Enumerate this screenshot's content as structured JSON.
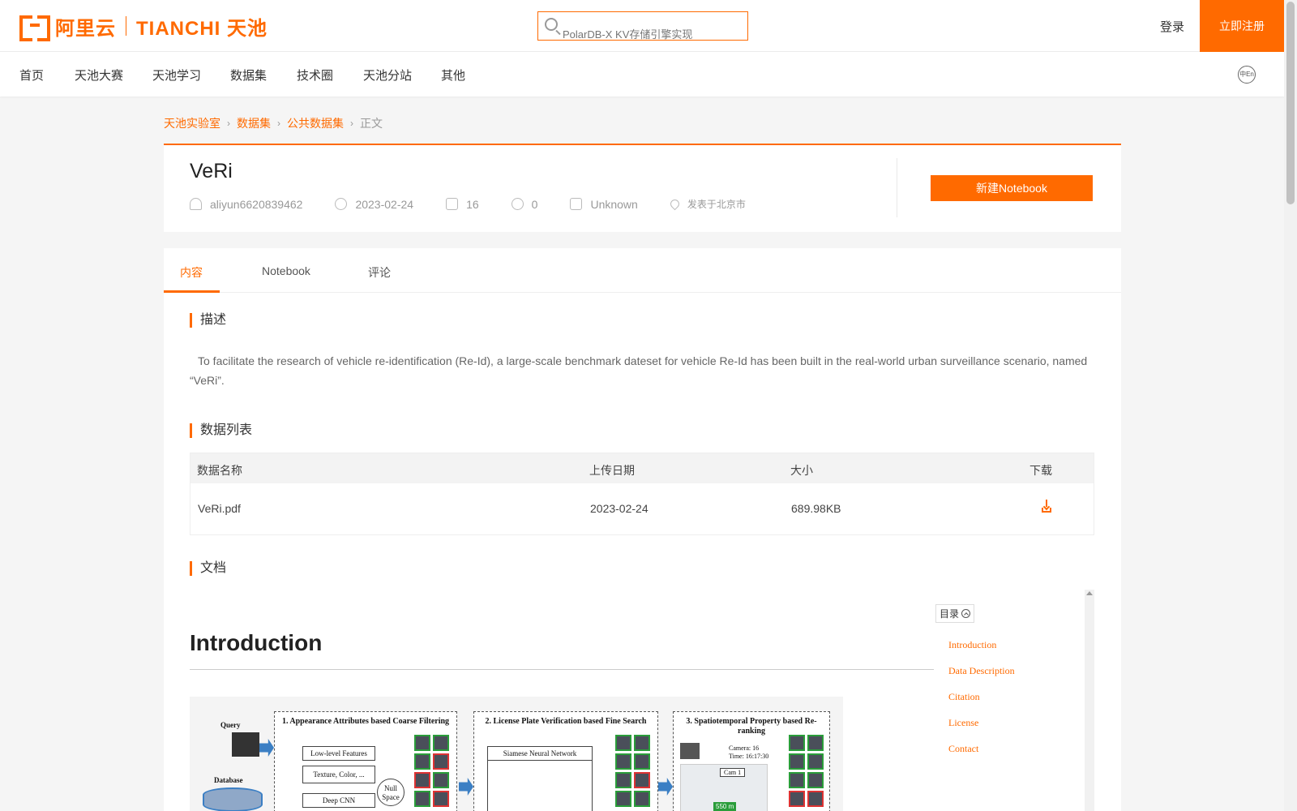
{
  "header": {
    "logo_cn": "阿里云",
    "logo_en": "TIANCHI 天池",
    "search_placeholder": "PolarDB-X KV存储引擎实现",
    "login": "登录",
    "register": "立即注册",
    "lang_icon": "中En"
  },
  "nav": {
    "items": [
      "首页",
      "天池大赛",
      "天池学习",
      "数据集",
      "技术圈",
      "天池分站",
      "其他"
    ]
  },
  "breadcrumb": {
    "items": [
      "天池实验室",
      "数据集",
      "公共数据集"
    ],
    "current": "正文"
  },
  "dataset": {
    "title": "VeRi",
    "author": "aliyun6620839462",
    "date": "2023-02-24",
    "downloads": "16",
    "shares": "0",
    "license": "Unknown",
    "location": "发表于北京市",
    "new_notebook": "新建Notebook"
  },
  "tabs": [
    {
      "label": "内容",
      "active": true
    },
    {
      "label": "Notebook",
      "active": false
    },
    {
      "label": "评论",
      "active": false
    }
  ],
  "sections": {
    "description_title": "描述",
    "description_text": "To facilitate the research of vehicle re-identification (Re-Id), a large-scale benchmark dateset for vehicle Re-Id has been built in the real-world urban surveillance scenario, named “VeRi”.",
    "data_list_title": "数据列表",
    "doc_title": "文档"
  },
  "table": {
    "headers": [
      "数据名称",
      "上传日期",
      "大小",
      "下载"
    ],
    "rows": [
      {
        "name": "VeRi.pdf",
        "date": "2023-02-24",
        "size": "689.98KB"
      }
    ]
  },
  "document": {
    "heading": "Introduction",
    "figure": {
      "query_label": "Query",
      "database_label": "Database",
      "stage1_title": "1. Appearance Attributes based Coarse Filtering",
      "stage1_box1": "Low-level Features",
      "stage1_box2": "Texture, Color, ...",
      "stage1_box3": "Deep CNN",
      "stage1_null": "Null Space",
      "stage2_title": "2. License Plate Verification based Fine Search",
      "stage2_box1": "Siamese Neural Network",
      "stage3_title": "3. Spatiotemporal Property based Re-ranking",
      "stage3_cam": "Camera: 16",
      "stage3_time": "Time: 16:17:30",
      "stage3_cam1": "Cam 1",
      "stage3_dist": "550 m"
    },
    "toc_label": "目录",
    "toc": [
      "Introduction",
      "Data Description",
      "Citation",
      "License",
      "Contact"
    ]
  },
  "colors": {
    "accent": "#ff6a00"
  }
}
